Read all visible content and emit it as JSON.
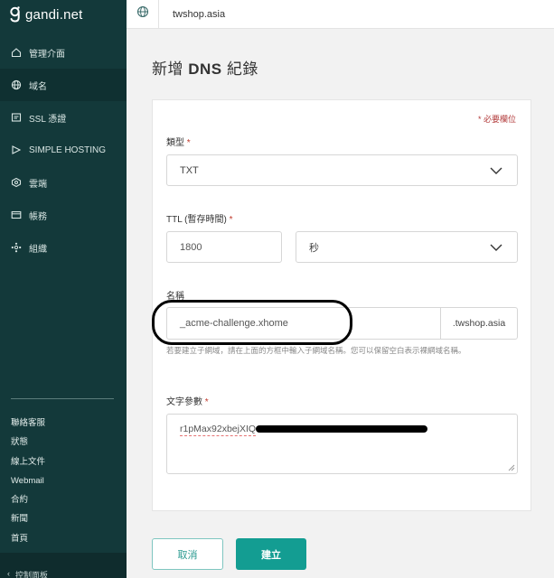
{
  "brand": {
    "name": "gandi.net"
  },
  "sidebar": {
    "items": [
      {
        "label": "管理介面",
        "icon": "home-icon"
      },
      {
        "label": "域名",
        "icon": "globe-icon",
        "active": true
      },
      {
        "label": "SSL 憑證",
        "icon": "certificate-icon"
      },
      {
        "label": "SIMPLE HOSTING",
        "icon": "hosting-icon"
      },
      {
        "label": "雲端",
        "icon": "cloud-icon"
      },
      {
        "label": "帳務",
        "icon": "billing-icon"
      },
      {
        "label": "組織",
        "icon": "organization-icon"
      }
    ],
    "footer_links": [
      "聯絡客服",
      "狀態",
      "線上文件",
      "Webmail",
      "合約",
      "新聞",
      "首頁"
    ],
    "bottom_label": "控制面板"
  },
  "topbar": {
    "domain": "twshop.asia"
  },
  "page": {
    "title_prefix": "新增 ",
    "title_strong": "DNS",
    "title_suffix": " 紀錄"
  },
  "form": {
    "required_note": "* 必要欄位",
    "type": {
      "label": "類型",
      "value": "TXT"
    },
    "ttl": {
      "label": "TTL (暫存時間)",
      "value": "1800",
      "unit": "秒"
    },
    "name": {
      "label": "名稱",
      "value": "_acme-challenge.xhome",
      "suffix": ".twshop.asia",
      "help": "若要建立子網域，請在上面的方框中輸入子網域名稱。您可以保留空白表示裸網域名稱。"
    },
    "text_value": {
      "label": "文字參數",
      "value": "r1pMax92xbejXIQ"
    }
  },
  "buttons": {
    "cancel": "取消",
    "submit": "建立"
  },
  "colors": {
    "sidebar_bg": "#13393a",
    "accent": "#139d92",
    "required": "#c0392b"
  }
}
